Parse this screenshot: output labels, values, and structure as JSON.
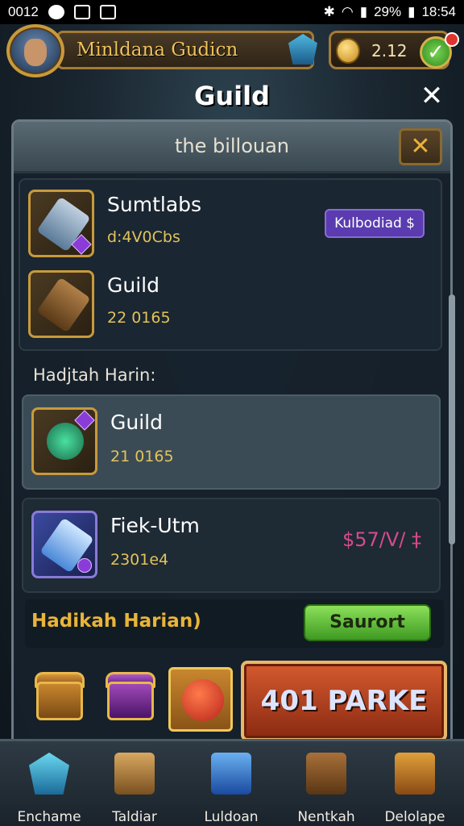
{
  "status_bar": {
    "left_text": "0012",
    "battery": "29%",
    "time": "18:54"
  },
  "player": {
    "name": "Minldana Gudicn",
    "currency": "2.12"
  },
  "screen_title": "Guild",
  "panel": {
    "subtitle": "the billouan",
    "items": [
      {
        "name": "Sumtlabs",
        "sub": "d:4V0Cbs",
        "tag": "Kulbodiad $"
      },
      {
        "name": "Guild",
        "sub": "22 0165"
      }
    ],
    "section_label": "Hadjtah Harin:",
    "section_items": [
      {
        "name": "Guild",
        "sub": "21 0165"
      },
      {
        "name": "Fiek-Utm",
        "sub": "2301e4",
        "price": "$57/V/ ‡"
      }
    ],
    "daily_label": "Hadikah Harian)",
    "claim_label": "Saurort",
    "big_button": "401 PARKE"
  },
  "bottom_nav": [
    {
      "label": "Enchame",
      "icon": "crystal-icon"
    },
    {
      "label": "Taldiar",
      "icon": "scroll-icon"
    },
    {
      "label": "Luldoan",
      "icon": "blue-chest-icon"
    },
    {
      "label": "Nentkah",
      "icon": "crate-icon"
    },
    {
      "label": "Delolape",
      "icon": "treasure-icon"
    }
  ],
  "colors": {
    "gold": "#e8b43a",
    "claim_green": "#5ec03a",
    "big_button_red": "#c04a24",
    "tag_purple": "#5a3cb0"
  }
}
